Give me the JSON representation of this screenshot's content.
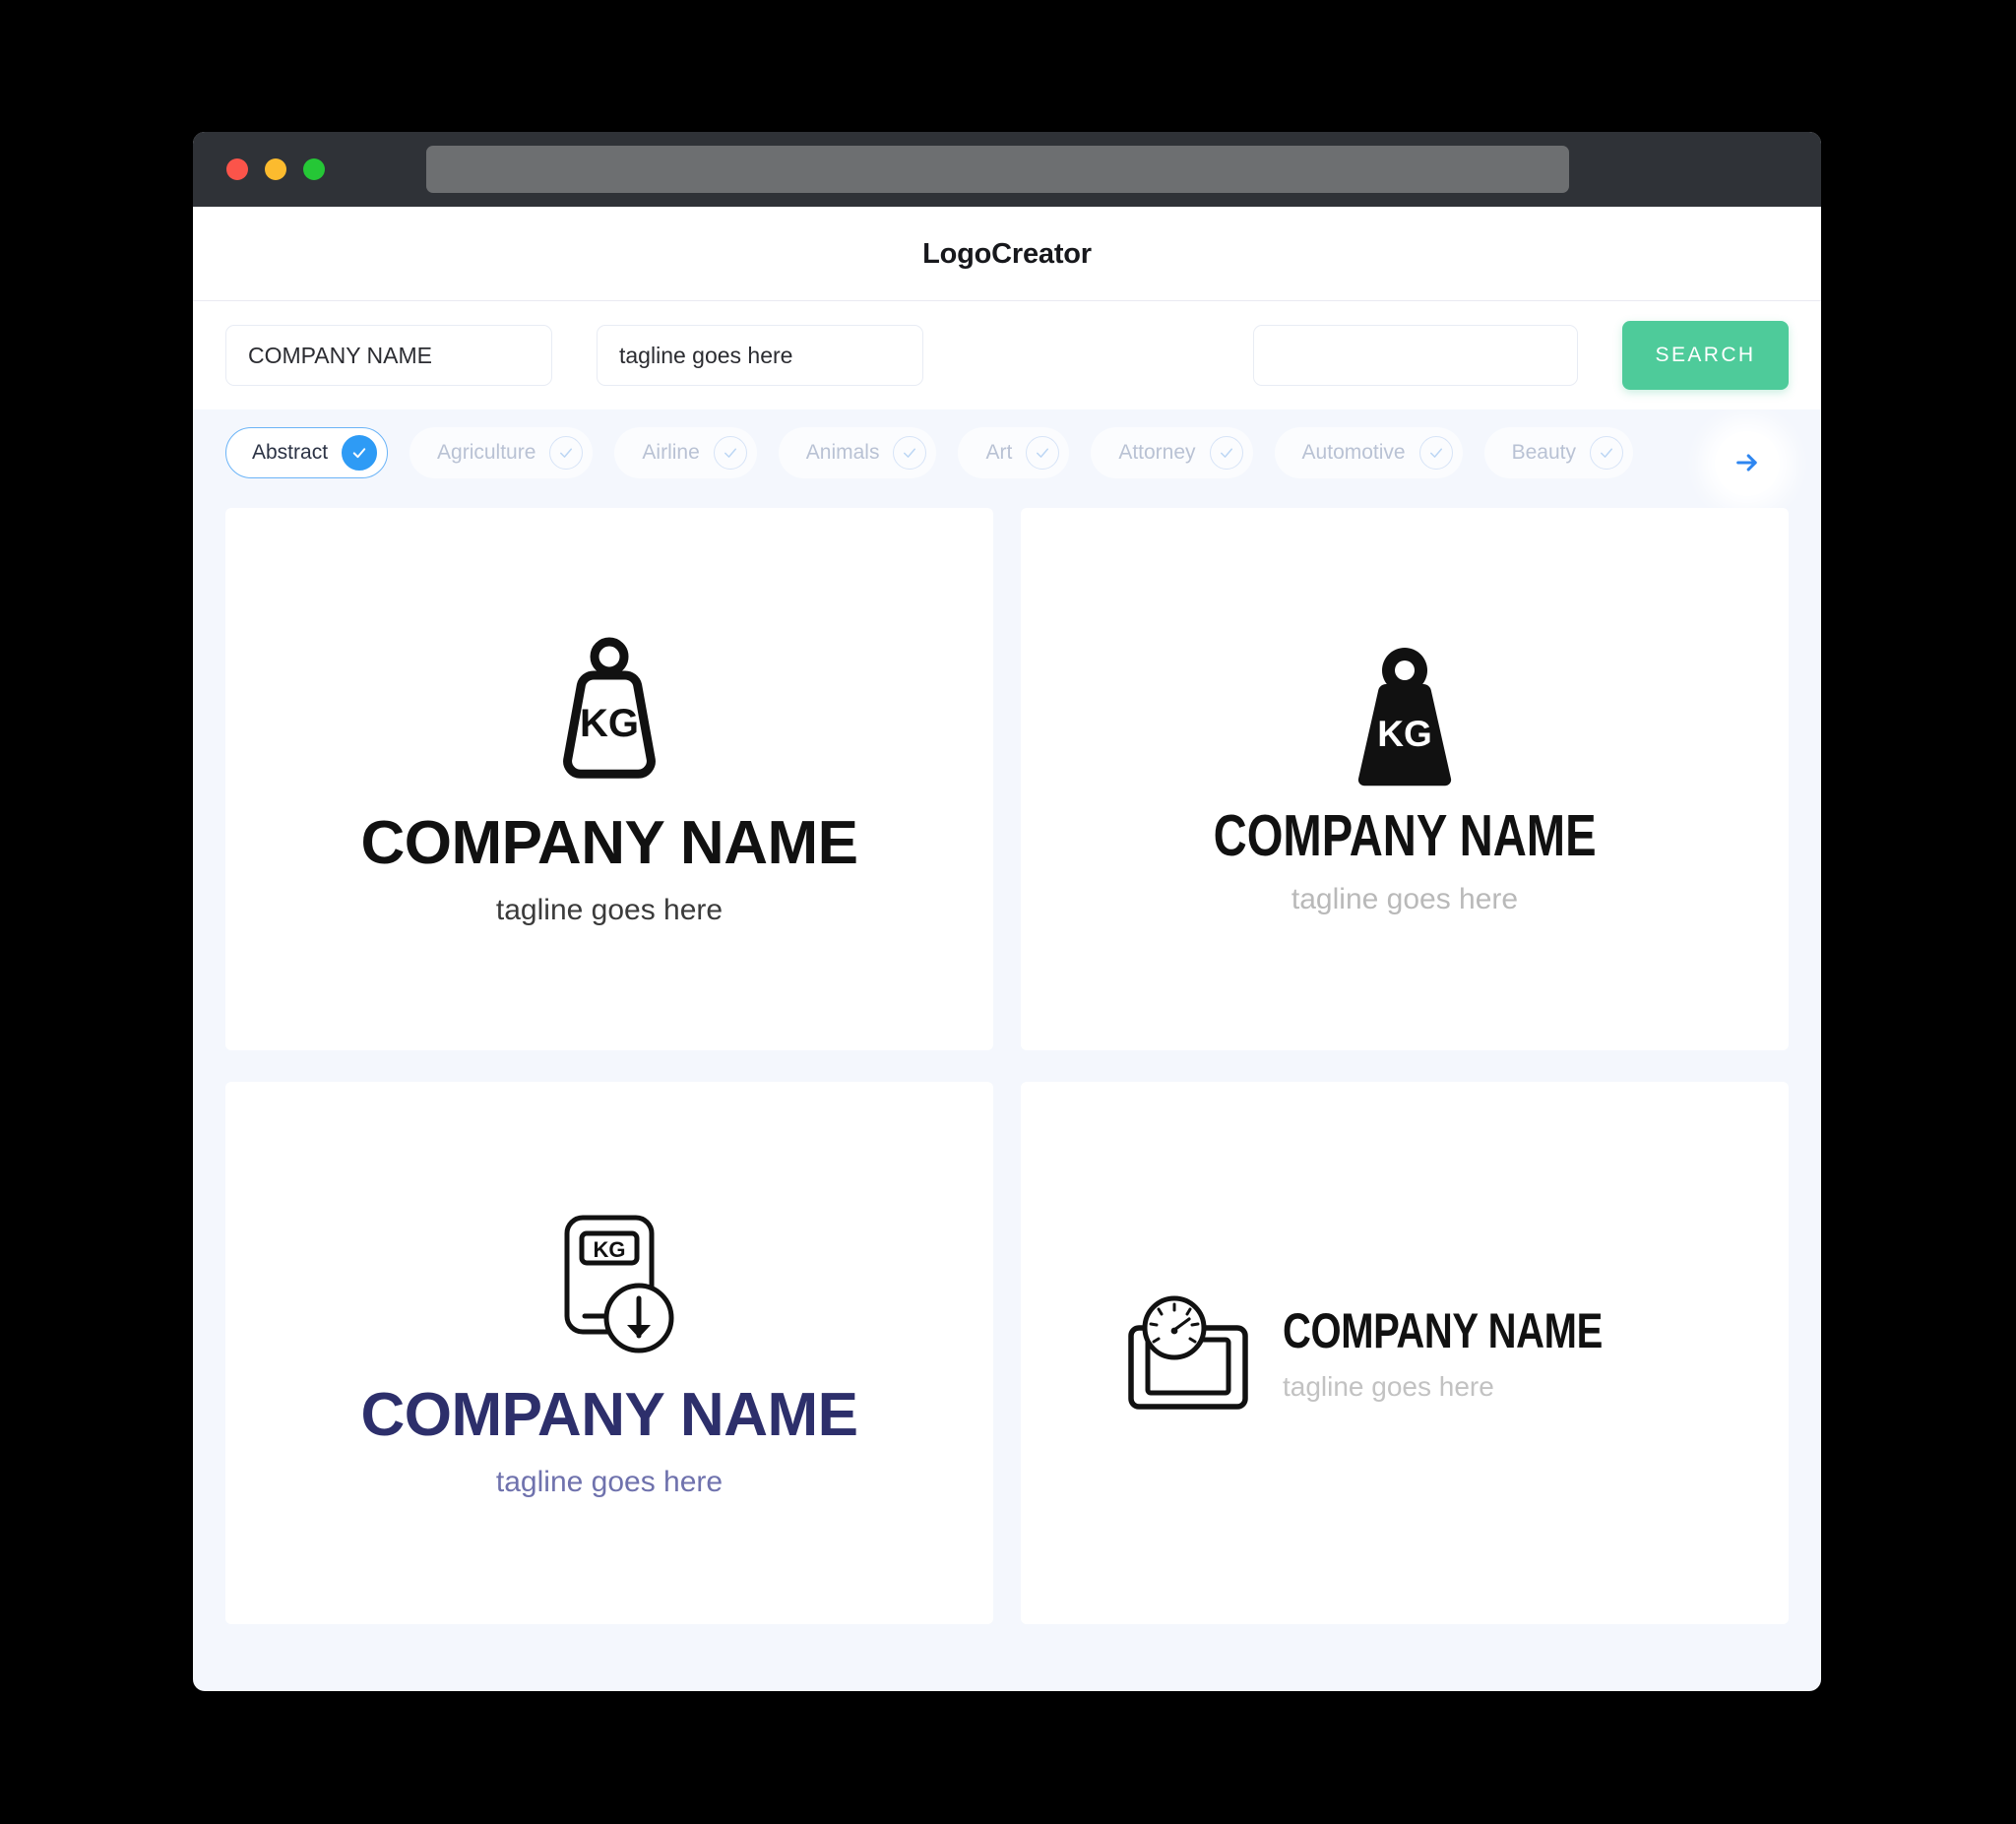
{
  "window": {
    "traffic_lights": [
      "close",
      "minimize",
      "maximize"
    ],
    "url_value": ""
  },
  "header": {
    "title": "LogoCreator"
  },
  "search": {
    "company_value": "COMPANY NAME",
    "company_placeholder": "COMPANY NAME",
    "tagline_value": "tagline goes here",
    "tagline_placeholder": "tagline goes here",
    "extra_value": "",
    "extra_placeholder": "",
    "button_label": "SEARCH",
    "button_color": "#4ecb9a"
  },
  "categories": {
    "selected": "Abstract",
    "accent_color": "#2e9bf5",
    "next_label": "→",
    "items": [
      {
        "label": "Abstract",
        "selected": true
      },
      {
        "label": "Agriculture",
        "selected": false
      },
      {
        "label": "Airline",
        "selected": false
      },
      {
        "label": "Animals",
        "selected": false
      },
      {
        "label": "Art",
        "selected": false
      },
      {
        "label": "Attorney",
        "selected": false
      },
      {
        "label": "Automotive",
        "selected": false
      },
      {
        "label": "Beauty",
        "selected": false
      }
    ]
  },
  "results": {
    "cards": [
      {
        "mark": "kg-weight-outline-icon",
        "mark_text": "KG",
        "brand": "COMPANY NAME",
        "tagline": "tagline goes here",
        "brand_color": "#111111",
        "tagline_color": "#3b3b3b",
        "layout": "stacked"
      },
      {
        "mark": "kg-weight-solid-icon",
        "mark_text": "KG",
        "brand": "COMPANY NAME",
        "tagline": "tagline goes here",
        "brand_color": "#111111",
        "tagline_color": "#b9b9b9",
        "layout": "stacked"
      },
      {
        "mark": "kg-scale-download-icon",
        "mark_text": "KG",
        "brand": "COMPANY NAME",
        "tagline": "tagline goes here",
        "brand_color": "#2d2f6b",
        "tagline_color": "#6f72ad",
        "layout": "stacked"
      },
      {
        "mark": "bathroom-scale-dial-icon",
        "mark_text": "",
        "brand": "COMPANY NAME",
        "tagline": "tagline goes here",
        "brand_color": "#111111",
        "tagline_color": "#c2c2c2",
        "layout": "horizontal"
      }
    ]
  }
}
